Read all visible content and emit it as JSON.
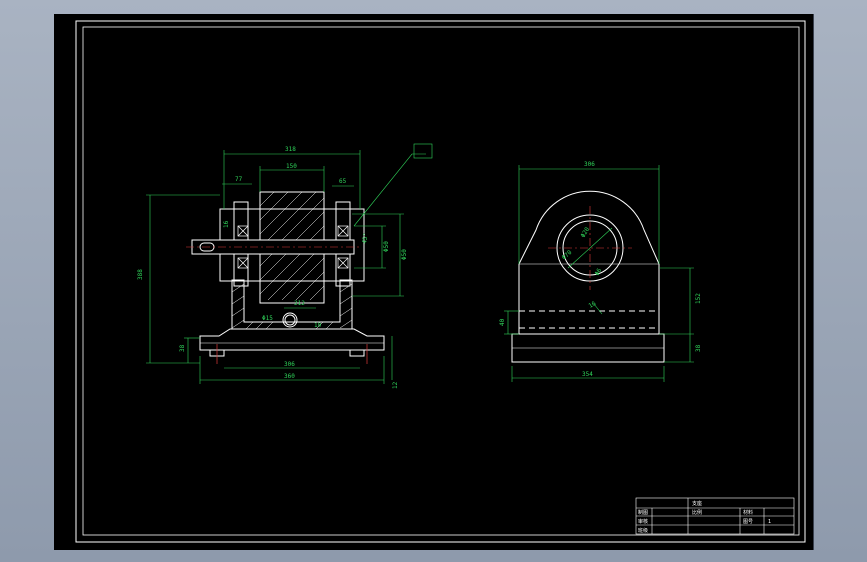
{
  "colors": {
    "outline": "#ffffff",
    "dimension": "#2fd45a",
    "center_line": "#e03a3a",
    "canvas": "#000000"
  },
  "front_view": {
    "dims": {
      "overall_width_top": "318",
      "roller_width": "150",
      "left_offset": "77",
      "right_offset": "65",
      "overall_height": "388",
      "base_height": "38",
      "bolt_span": "306",
      "base_width": "360",
      "shaft_hole": "Φ15",
      "bore_mid": "Φ50",
      "bore_outer": "Φ50",
      "angle": "45°",
      "small_a": "16",
      "small_b": "10",
      "small_c": "12",
      "mid_label": "212"
    }
  },
  "side_view": {
    "dims": {
      "top_width": "306",
      "height_right": "152",
      "base_height": "38",
      "left_height": "40",
      "base_width": "354",
      "bore_inner": "Φ70",
      "bore_outer": "Φ20",
      "hole_note": "Φ6",
      "slot_note": "16"
    }
  },
  "title_block": {
    "name": "支座",
    "scale_label": "比例",
    "row1_label": "制图",
    "row2_label": "审核",
    "row3_label": "班级",
    "material_label": "材料",
    "sheet_label": "图号",
    "sheet_value": "1"
  }
}
